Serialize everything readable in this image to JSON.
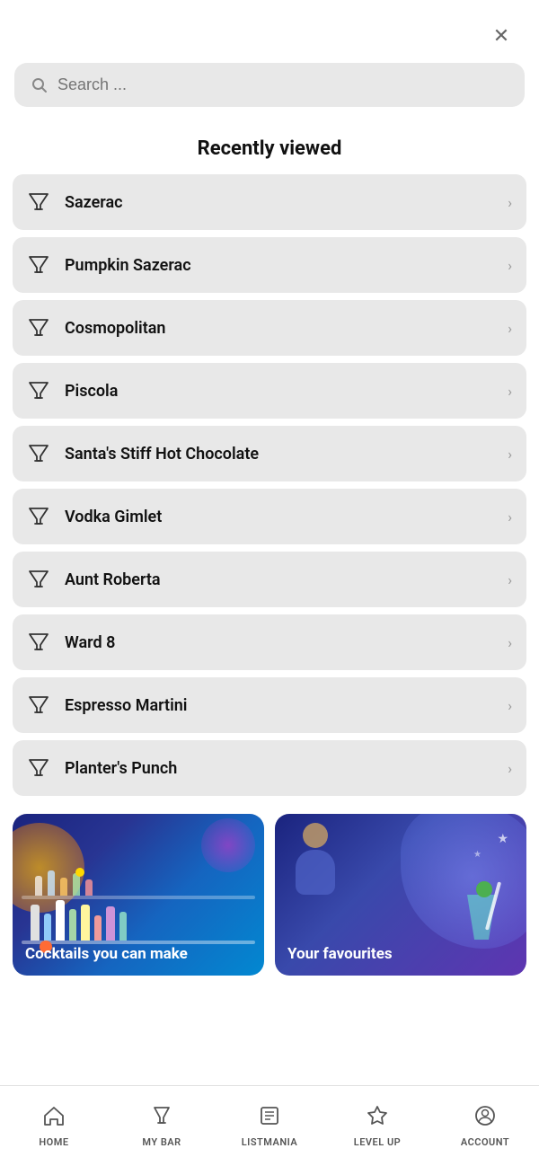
{
  "header": {
    "close_label": "×"
  },
  "search": {
    "placeholder": "Search ..."
  },
  "recently_viewed": {
    "title": "Recently viewed",
    "items": [
      {
        "id": 1,
        "name": "Sazerac"
      },
      {
        "id": 2,
        "name": "Pumpkin Sazerac"
      },
      {
        "id": 3,
        "name": "Cosmopolitan"
      },
      {
        "id": 4,
        "name": "Piscola"
      },
      {
        "id": 5,
        "name": "Santa's Stiff Hot Chocolate"
      },
      {
        "id": 6,
        "name": "Vodka Gimlet"
      },
      {
        "id": 7,
        "name": "Aunt Roberta"
      },
      {
        "id": 8,
        "name": "Ward 8"
      },
      {
        "id": 9,
        "name": "Espresso Martini"
      },
      {
        "id": 10,
        "name": "Planter's Punch"
      }
    ]
  },
  "cards": {
    "card1_label": "Cocktails you can make",
    "card2_label": "Your favourites"
  },
  "bottom_nav": {
    "items": [
      {
        "id": "home",
        "label": "HOME",
        "icon": "⌂"
      },
      {
        "id": "mybar",
        "label": "MY BAR",
        "icon": "🍸"
      },
      {
        "id": "listmania",
        "label": "LISTMANIA",
        "icon": "▦"
      },
      {
        "id": "levelup",
        "label": "LEVEL UP",
        "icon": "🎓"
      },
      {
        "id": "account",
        "label": "ACCOUNT",
        "icon": "👤"
      }
    ]
  },
  "icons": {
    "cocktail_glass": "🍸",
    "search": "🔍",
    "chevron": "›",
    "close": "✕"
  }
}
